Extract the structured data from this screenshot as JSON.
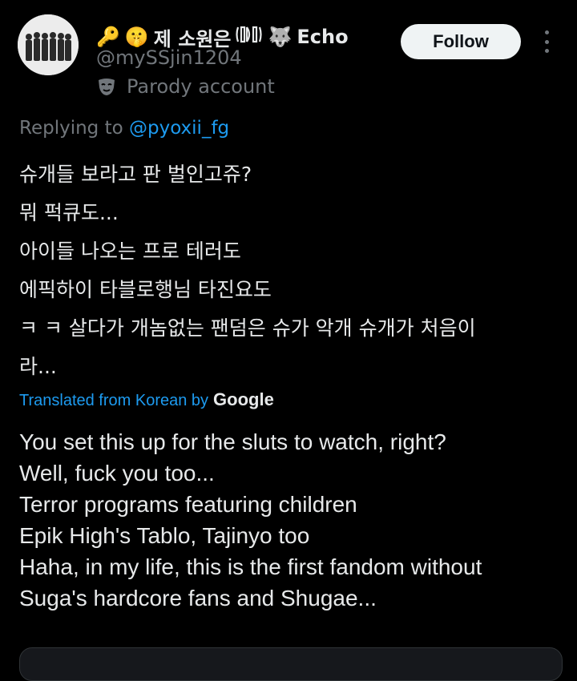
{
  "user": {
    "display_name": "제 소원은",
    "display_name_suffix": "Echo",
    "handle": "@mySSjin1204",
    "badge": "Parody account"
  },
  "header": {
    "follow_label": "Follow"
  },
  "reply": {
    "prefix": "Replying to ",
    "mention": "@pyoxii_fg"
  },
  "post": {
    "korean_lines": [
      "슈개들 보라고 판 벌인고쥬?",
      "뭐 퍽큐도...",
      "아이들 나오는 프로 테러도",
      "에픽하이 타블로행님 타진요도",
      "ㅋ ㅋ 살다가 개놈없는 팬덤은 슈가 악개 슈개가 처음이",
      "라..."
    ],
    "translation_label": "Translated from Korean by",
    "translation_provider": "Google",
    "english_lines": [
      "You set this up for the sluts to watch, right?",
      "Well, fuck you too...",
      "Terror programs featuring children",
      "Epik High's Tablo, Tajinyo too",
      "Haha, in my life, this is the first fandom without",
      "Suga's hardcore fans and Shugae..."
    ]
  },
  "icons": [
    "key-emoji",
    "shushing-face-emoji",
    "fandom-logo-icon",
    "wolf-emoji",
    "mask-icon",
    "more-options-icon"
  ],
  "colors": {
    "background": "#000000",
    "text": "#e7e9ea",
    "secondary": "#71767b",
    "link": "#1d9bf0",
    "button_bg": "#eff3f4"
  }
}
